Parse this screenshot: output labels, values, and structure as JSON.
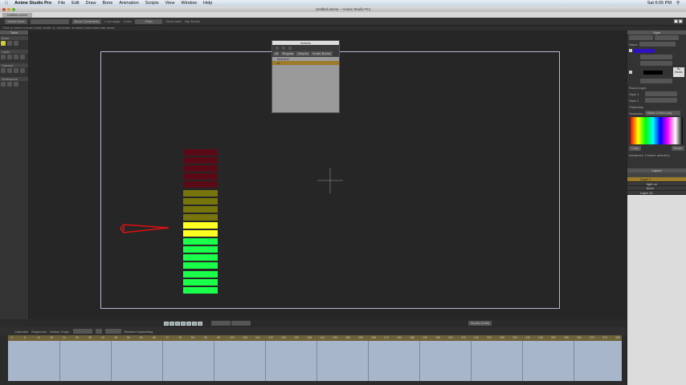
{
  "menubar": {
    "app": "Anime Studio Pro",
    "items": [
      "File",
      "Edit",
      "Draw",
      "Bone",
      "Animation",
      "Scripts",
      "View",
      "Window",
      "Help"
    ],
    "clock": "Sat 6:05 PM"
  },
  "window": {
    "title": "Untitled.anime – Anime Studio Pro",
    "tab": "Untitled.anime"
  },
  "toolbar": {
    "select_bone": "Select Bone",
    "bone_constraints": "Bone Constraints",
    "lock_angle": "Lock angle",
    "color_label": "Color:",
    "color_value": "Plain",
    "show_label": "Show label",
    "slip_bones": "Slip Bones"
  },
  "status": "Click to select a bone (hold <shift> or <ctrl/cmd> to select more than one bone)",
  "tools": {
    "title": "Tools",
    "sections": [
      "Bone",
      "Layer",
      "Camera",
      "Workspace"
    ]
  },
  "actions": {
    "title": "Actions",
    "tabs": [
      "All",
      "Regular",
      "Morphs",
      "Smart Bones"
    ],
    "items": [
      "Mainline",
      "t1"
    ]
  },
  "style": {
    "title": "Style",
    "name_label": "Name",
    "round_caps": "Round caps",
    "style1": "Style 1",
    "style2": "Style 2",
    "thickness": "Thickness",
    "swatches": "Swatches",
    "swatch_value": "Basic Colors.png",
    "no_brush": "No Brush",
    "copy": "Copy",
    "reset": "Reset",
    "advanced": "Advanced",
    "cleaner_selection": "Cleaner selection"
  },
  "layers": {
    "title": "Layers",
    "items": [
      "Layer 1",
      "light on",
      "bone",
      "Layer 10"
    ]
  },
  "timeline": {
    "tabs": [
      "Channels",
      "Sequencer",
      "Motion Graph"
    ],
    "relative_keyframing": "Relative Keyframing",
    "display_quality": "Display Quality",
    "ruler": [
      0,
      6,
      12,
      18,
      24,
      30,
      36,
      42,
      48,
      54,
      60,
      66,
      72,
      78,
      84,
      90,
      96,
      102,
      108,
      114,
      120,
      126,
      132,
      138,
      144,
      150,
      156,
      162,
      168,
      174,
      180,
      186,
      192,
      198,
      204,
      210,
      216,
      222,
      228,
      234,
      240,
      246,
      252,
      258,
      264,
      270,
      276,
      282
    ]
  },
  "meter": {
    "segments": [
      "#5a0a16",
      "#5a0a16",
      "#5a0a16",
      "#5a0a16",
      "#5a0a16",
      "#76740a",
      "#76740a",
      "#76740a",
      "#76740a",
      "#ffff22",
      "#ffff22",
      "#1aff4a",
      "#1aff4a",
      "#1aff4a",
      "#1aff4a",
      "#1aff4a",
      "#1aff4a",
      "#1aff4a"
    ],
    "pointer_color": "#e01010"
  }
}
